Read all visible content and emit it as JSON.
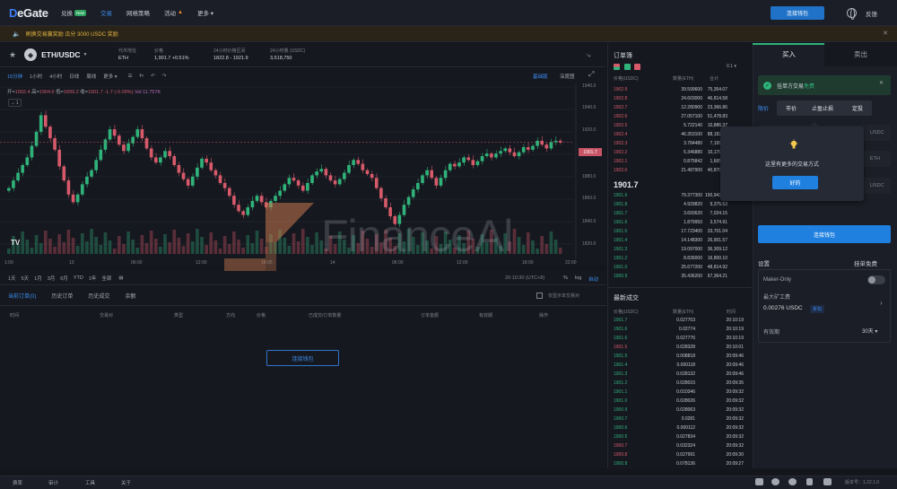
{
  "nav": {
    "logo_prefix": "D",
    "logo_rest": "eGate",
    "items": [
      {
        "label": "兑换",
        "badge": "New"
      },
      {
        "label": "交易",
        "active": true
      },
      {
        "label": "网格策略"
      },
      {
        "label": "活动",
        "icon": "fire-icon"
      },
      {
        "label": "更多 ▾"
      }
    ],
    "connect_wallet": "连接钱包",
    "feedback": "反馈"
  },
  "announcement": "刷换交易赢奖励 瓜分 3000 USDC 奖励",
  "pair": {
    "name": "ETH/USDC",
    "token_address_label": "代币地址",
    "token_address_value": "ETH",
    "price_label": "价格",
    "price_value": "1,901.7",
    "change_value": "+0.51%",
    "range_label": "24小时价格区间",
    "range_value": "1822.8 - 1921.9",
    "volume_label": "24小时量 (USDC)",
    "volume_value": "3,618,750"
  },
  "chart_tools": {
    "timeframes": [
      "15分钟",
      "1小时",
      "4小时",
      "日线",
      "周线",
      "更多 ▾"
    ],
    "active_timeframe": "15分钟",
    "basic": "基础版",
    "depth": "深度图"
  },
  "ohlc": {
    "open_label": "开=",
    "open": "1902.4",
    "high_label": "高=",
    "high": "1904.6",
    "low_label": "低=",
    "low": "1899.2",
    "close_label": "收=",
    "close": "1901.7",
    "change": "-1.7 (-0.09%)",
    "vol_label": "Vol",
    "vol": "11.757K",
    "one": "1"
  },
  "chart_data": {
    "type": "candlestick",
    "y_ticks": [
      "1940.0",
      "1920.0",
      "1900.0",
      "1880.0",
      "1860.0",
      "1840.0",
      "1820.0",
      "1800.0"
    ],
    "x_ticks": [
      "1:00",
      "13",
      "06:00",
      "12:00",
      "18:00",
      "14",
      "06:00",
      "12:00",
      "18:00",
      "22:00"
    ],
    "last_price": "1901.7",
    "close_series": [
      1866,
      1872,
      1878,
      1884,
      1890,
      1899,
      1910,
      1923,
      1914,
      1905,
      1896,
      1883,
      1872,
      1861,
      1855,
      1861,
      1869,
      1875,
      1880,
      1888,
      1896,
      1904,
      1912,
      1907,
      1900,
      1895,
      1901,
      1906,
      1912,
      1905,
      1897,
      1890,
      1886,
      1890,
      1895,
      1891,
      1884,
      1878,
      1873,
      1868,
      1875,
      1882,
      1889,
      1886,
      1880,
      1876,
      1870,
      1866,
      1860,
      1853,
      1848,
      1845,
      1851,
      1856,
      1860,
      1855,
      1851,
      1856,
      1860,
      1864,
      1869,
      1874,
      1872,
      1868,
      1864,
      1870,
      1876,
      1879,
      1881,
      1876,
      1872,
      1869,
      1873,
      1878,
      1884,
      1888,
      1885,
      1880,
      1877,
      1874,
      1866,
      1858,
      1851,
      1844,
      1838,
      1845,
      1853,
      1859,
      1865,
      1870,
      1876,
      1880,
      1874,
      1868,
      1874,
      1880,
      1885,
      1883,
      1886,
      1890,
      1888,
      1884,
      1887,
      1891,
      1893,
      1890,
      1893,
      1895,
      1897,
      1894,
      1891,
      1894,
      1898,
      1896,
      1899,
      1903,
      1900,
      1897,
      1902,
      1903,
      1901.7
    ]
  },
  "watermark_text": "FinanceAl",
  "ranges": {
    "items": [
      "1天",
      "5天",
      "1月",
      "3月",
      "6月",
      "YTD",
      "1年",
      "全部"
    ],
    "timestamp": "20:10:30 (UTC+8)",
    "pct": "%",
    "log": "log",
    "auto": "自动"
  },
  "orders": {
    "tabs": [
      "当前订单(0)",
      "历史订单",
      "历史成交",
      "余额"
    ],
    "only_current": "仅显示本交易对",
    "headers": [
      "时间",
      "交易对",
      "类型",
      "方向",
      "价格",
      "已成交/订单数量",
      "订单金额",
      "有效期",
      "操作"
    ],
    "connect": "连接钱包"
  },
  "orderbook": {
    "title": "订单簿",
    "step": "0.1 ▾",
    "headers": [
      "价格(USDC)",
      "数量(ETH)",
      "合计"
    ],
    "asks": [
      [
        "1902.9",
        "39.599600",
        "75,354.07"
      ],
      [
        "1902.8",
        "24.603000",
        "46,814.58"
      ],
      [
        "1902.7",
        "12.280900",
        "23,366.86"
      ],
      [
        "1902.6",
        "27.057100",
        "51,478.83"
      ],
      [
        "1902.5",
        "5.722140",
        "10,886.37"
      ],
      [
        "1902.4",
        "46.353100",
        "88,182.13"
      ],
      [
        "1902.3",
        "3.784480",
        "7,199.31"
      ],
      [
        "1902.2",
        "5.346880",
        "10,170.83"
      ],
      [
        "1902.1",
        "0.875842",
        "1,665.95"
      ],
      [
        "1902.0",
        "21.487900",
        "40,870.01"
      ]
    ],
    "mid": "1901.7",
    "bids": [
      [
        "1901.6",
        "79.377300",
        "150,943.90"
      ],
      [
        "1901.8",
        "4.929820",
        "9,375.53"
      ],
      [
        "1901.7",
        "3.693620",
        "7,024.15"
      ],
      [
        "1901.6",
        "1.879950",
        "3,574.91"
      ],
      [
        "1901.5",
        "17.723400",
        "33,701.04"
      ],
      [
        "1901.4",
        "14.148300",
        "26,901.57"
      ],
      [
        "1901.3",
        "19.097000",
        "36,309.12"
      ],
      [
        "1901.2",
        "8.836000",
        "16,800.10"
      ],
      [
        "1901.0",
        "25.677200",
        "48,814.92"
      ],
      [
        "1900.9",
        "35.436200",
        "67,364.21"
      ]
    ]
  },
  "trades": {
    "title": "最新成交",
    "headers": [
      "价格(USDC)",
      "数量(ETH)",
      "时间"
    ],
    "rows": [
      [
        "1901.7",
        "0.027703",
        "20:10:19",
        "g"
      ],
      [
        "1901.6",
        "0.02774",
        "20:10:19",
        "g"
      ],
      [
        "1901.6",
        "0.027776",
        "20:10:19",
        "g"
      ],
      [
        "1901.5",
        "0.028328",
        "20:10:01",
        "r"
      ],
      [
        "1901.5",
        "0.008818",
        "20:09:46",
        "g"
      ],
      [
        "1901.4",
        "0.000118",
        "20:09:46",
        "g"
      ],
      [
        "1901.3",
        "0.028132",
        "20:09:46",
        "g"
      ],
      [
        "1901.2",
        "0.028015",
        "20:09:35",
        "g"
      ],
      [
        "1901.1",
        "0.010346",
        "20:09:32",
        "g"
      ],
      [
        "1901.0",
        "0.028026",
        "20:09:32",
        "g"
      ],
      [
        "1900.9",
        "0.028063",
        "20:09:32",
        "g"
      ],
      [
        "1900.7",
        "0.0281",
        "20:09:32",
        "g"
      ],
      [
        "1900.6",
        "0.000112",
        "20:09:32",
        "g"
      ],
      [
        "1900.5",
        "0.027834",
        "20:09:32",
        "g"
      ],
      [
        "1900.7",
        "0.032324",
        "20:09:32",
        "r"
      ],
      [
        "1900.8",
        "0.027991",
        "20:09:30",
        "r"
      ],
      [
        "1900.8",
        "0.078136",
        "20:09:27",
        "g"
      ]
    ]
  },
  "trade_panel": {
    "buy": "买入",
    "sell": "卖出",
    "fee_banner_pre": "挂单方交易",
    "fee_banner_hl": "免费",
    "order_types": [
      "限价",
      "市价",
      "止盈止损",
      "定投"
    ],
    "unit_usdc": "USDC",
    "unit_eth": "ETH",
    "popup_text": "这里有更多的交易方式",
    "popup_ok": "好的",
    "connect": "连接钱包",
    "settings": "设置",
    "free": "挂单免费",
    "maker_only": "Maker-Only",
    "max_fee_label": "最大矿工费",
    "max_fee_value": "0.00276 USDC",
    "max_fee_badge": "折扣",
    "validity_label": "有效期",
    "validity_value": "30天 ▾"
  },
  "footer": {
    "links": [
      "费率",
      "审计",
      "工具",
      "关于"
    ],
    "version": "版本号：1.22.1.0"
  },
  "colors": {
    "up": "#2fb37a",
    "down": "#d75a6a",
    "accent": "#1f80e0"
  }
}
